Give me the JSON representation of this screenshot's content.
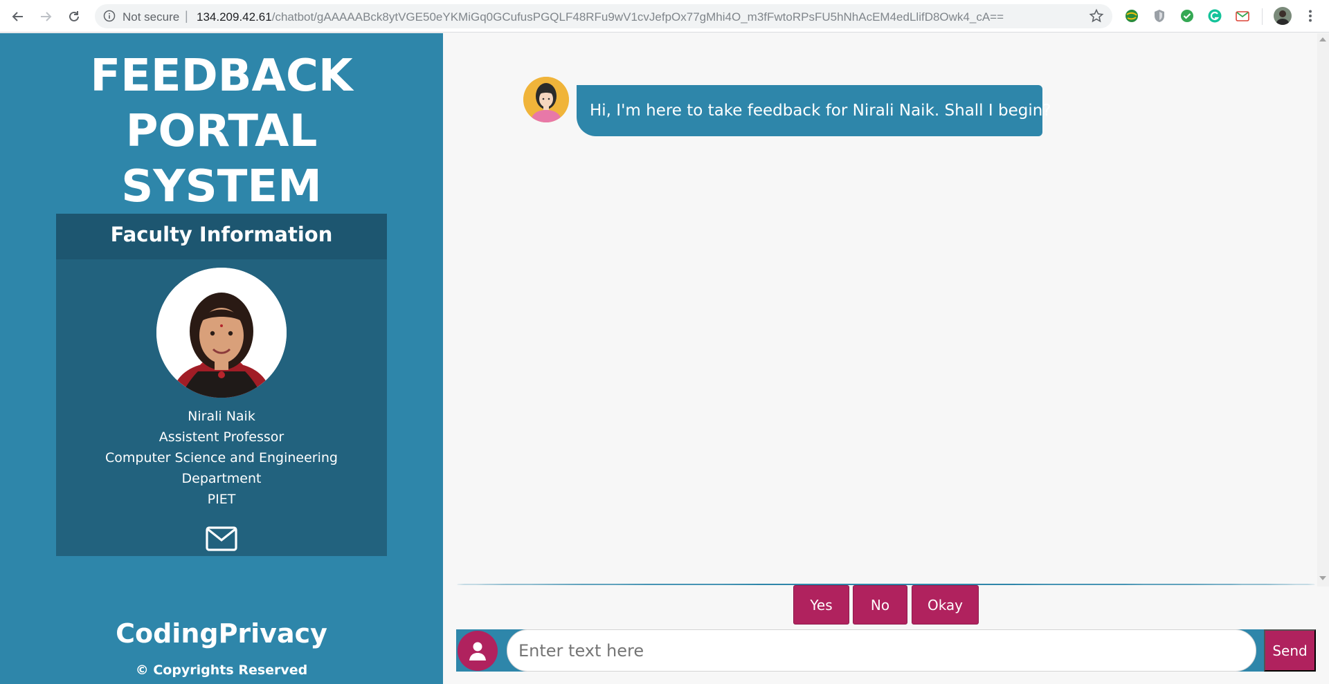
{
  "browser": {
    "security_label": "Not secure",
    "separator": "|",
    "url_host": "134.209.42.61",
    "url_path": "/chatbot/gAAAAABck8ytVGE50eYKMiGq0GCufusPGQLF48RFu9wV1cvJefpOx77gMhi4O_m3fFwtoRPsFU5hNhAcEM4edLlifD8Owk4_cA==",
    "icons": [
      "back-arrow-icon",
      "forward-arrow-icon",
      "reload-icon",
      "info-icon",
      "star-icon",
      "extension-globe-icon",
      "extension-shield-icon",
      "extension-check-icon",
      "extension-grammarly-icon",
      "extension-mail-icon",
      "profile-avatar-icon",
      "kebab-menu-icon"
    ]
  },
  "sidebar": {
    "title_line1": "FEEDBACK PORTAL",
    "title_line2": "SYSTEM",
    "faculty": {
      "heading": "Faculty Information",
      "name": "Nirali Naik",
      "designation": "Assistent Professor",
      "department_line1": "Computer Science and Engineering",
      "department_line2": "Department",
      "institute": "PIET"
    },
    "brand": "CodingPrivacy",
    "copyright": "© Copyrights Reserved"
  },
  "chat": {
    "bot_message": "Hi, I'm here to take feedback for Nirali Naik. Shall I begin?",
    "quick_replies": [
      "Yes",
      "No",
      "Okay"
    ],
    "input_placeholder": "Enter text here",
    "send_label": "Send"
  },
  "colors": {
    "primary": "#2e86aa",
    "card": "#22627e",
    "accent": "#b0225e"
  }
}
